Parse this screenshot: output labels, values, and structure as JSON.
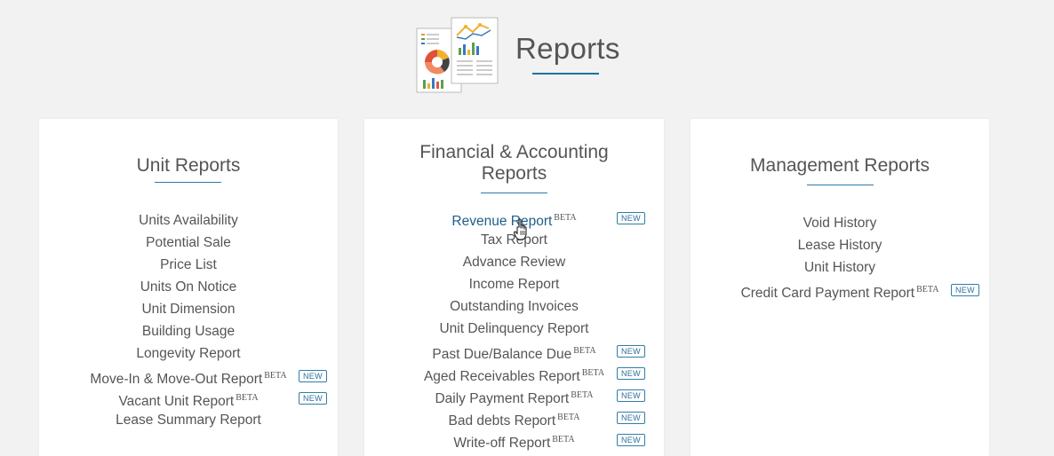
{
  "page": {
    "title": "Reports"
  },
  "colors": {
    "accent": "#1f6fa3",
    "active_link": "#1e5f8a",
    "badge": "#2f7ea8"
  },
  "cards": [
    {
      "title": "Unit Reports",
      "items": [
        {
          "label": "Units Availability"
        },
        {
          "label": "Potential Sale"
        },
        {
          "label": "Price List"
        },
        {
          "label": "Units On Notice"
        },
        {
          "label": "Unit Dimension"
        },
        {
          "label": "Building Usage"
        },
        {
          "label": "Longevity Report"
        },
        {
          "label": "Move-In & Move-Out Report",
          "beta": "BETA",
          "badge": "NEW"
        },
        {
          "label": "Vacant Unit Report",
          "beta": "BETA",
          "badge": "NEW"
        },
        {
          "label": "Lease Summary Report"
        }
      ]
    },
    {
      "title_line1": "Financial & Accounting",
      "title_line2": "Reports",
      "items": [
        {
          "label": "Revenue Report",
          "beta": "BETA",
          "badge": "NEW",
          "active": true
        },
        {
          "label": "Tax Report"
        },
        {
          "label": "Advance Review"
        },
        {
          "label": "Income Report"
        },
        {
          "label": "Outstanding Invoices"
        },
        {
          "label": "Unit Delinquency Report"
        },
        {
          "label": "Past Due/Balance Due",
          "beta": "BETA",
          "badge": "NEW"
        },
        {
          "label": "Aged Receivables Report",
          "beta": "BETA",
          "badge": "NEW"
        },
        {
          "label": "Daily Payment Report",
          "beta": "BETA",
          "badge": "NEW"
        },
        {
          "label": "Bad debts Report",
          "beta": "BETA",
          "badge": "NEW"
        },
        {
          "label": "Write-off Report",
          "beta": "BETA",
          "badge": "NEW"
        }
      ]
    },
    {
      "title": "Management Reports",
      "items": [
        {
          "label": "Void History"
        },
        {
          "label": "Lease History"
        },
        {
          "label": "Unit History"
        },
        {
          "label": "Credit Card Payment Report",
          "beta": "BETA",
          "badge": "NEW"
        }
      ]
    }
  ]
}
